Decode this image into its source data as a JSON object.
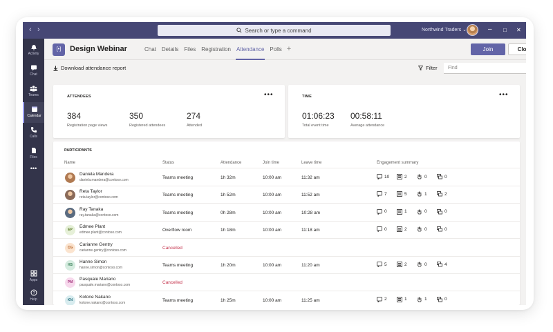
{
  "titlebar": {
    "search_placeholder": "Search or type a command",
    "org": "Northwind Traders",
    "back_glyph": "‹",
    "forward_glyph": "›",
    "minimize_glyph": "–",
    "restore_glyph": "□",
    "close_glyph": "✕",
    "org_chevron": "⌄"
  },
  "rail": [
    {
      "label": "Activity",
      "icon": "bell-icon"
    },
    {
      "label": "Chat",
      "icon": "chat-icon"
    },
    {
      "label": "Teams",
      "icon": "teams-icon"
    },
    {
      "label": "Calendar",
      "icon": "calendar-icon",
      "active": true
    },
    {
      "label": "Calls",
      "icon": "phone-icon"
    },
    {
      "label": "Files",
      "icon": "file-icon"
    },
    {
      "label": "Apps",
      "icon": "apps-icon"
    },
    {
      "label": "Help",
      "icon": "help-icon"
    }
  ],
  "rail_more": "•••",
  "header": {
    "channel_icon_text": "[•]",
    "title": "Design Webinar",
    "tabs": [
      "Chat",
      "Details",
      "Files",
      "Registration",
      "Attendance",
      "Polls"
    ],
    "active_tab": "Attendance",
    "add_tab": "+",
    "join_label": "Join",
    "close_label": "Close"
  },
  "toolbar": {
    "download_label": "Download attendance report",
    "filter_label": "Filter",
    "find_placeholder": "Find"
  },
  "attendees_card": {
    "title": "ATTENDEES",
    "more": "•••",
    "stats": [
      {
        "value": "384",
        "label": "Registration page views"
      },
      {
        "value": "350",
        "label": "Registered attendees"
      },
      {
        "value": "274",
        "label": "Attended"
      }
    ]
  },
  "time_card": {
    "title": "TIME",
    "more": "•••",
    "stats": [
      {
        "value": "01:06:23",
        "label": "Total event time"
      },
      {
        "value": "00:58:11",
        "label": "Average attendance"
      }
    ]
  },
  "participants": {
    "title": "PARTICIPANTS",
    "headers": {
      "name": "Name",
      "status": "Status",
      "attendance": "Attendance",
      "join": "Join time",
      "leave": "Leave time",
      "engagement": "Engagement summary"
    },
    "rows": [
      {
        "name": "Daniela Mandera",
        "email": "daniela.mandera@contoso.com",
        "initials": "",
        "avatar_color": "#b07a52",
        "status": "Teams meeting",
        "cancelled": false,
        "attendance": "1h 32m",
        "join": "10:00 am",
        "leave": "11:32 am",
        "engagement": [
          "10",
          "2",
          "0",
          "0"
        ]
      },
      {
        "name": "Reta Taylor",
        "email": "reta.taylor@contoso.com",
        "initials": "",
        "avatar_color": "#8a6a58",
        "status": "Teams meeting",
        "cancelled": false,
        "attendance": "1h 52m",
        "join": "10:00 am",
        "leave": "11:52 am",
        "engagement": [
          "7",
          "5",
          "1",
          "2"
        ]
      },
      {
        "name": "Ray Tanaka",
        "email": "ray.tanaka@contoso.com",
        "initials": "",
        "avatar_color": "#5a6b80",
        "status": "Teams meeting",
        "cancelled": false,
        "attendance": "0h 28m",
        "join": "10:00 am",
        "leave": "10:28 am",
        "engagement": [
          "0",
          "1",
          "0",
          "0"
        ]
      },
      {
        "name": "Edmee Plant",
        "email": "edmee.plant@contoso.com",
        "initials": "EP",
        "avatar_color": "#e6f0d8",
        "avatar_text": "#5b7a2a",
        "status": "Overflow room",
        "cancelled": false,
        "attendance": "1h 18m",
        "join": "10:00 am",
        "leave": "11:18 am",
        "engagement": [
          "0",
          "2",
          "0",
          "0"
        ]
      },
      {
        "name": "Carianne Gentry",
        "email": "carianne.gentry@contoso.com",
        "initials": "CG",
        "avatar_color": "#fbe4cf",
        "avatar_text": "#b0581a",
        "status": "Cancelled",
        "cancelled": true,
        "attendance": "",
        "join": "",
        "leave": "",
        "engagement": []
      },
      {
        "name": "Hanne Simon",
        "email": "hanne.simon@contoso.com",
        "initials": "HS",
        "avatar_color": "#d6ece0",
        "avatar_text": "#2f7a50",
        "status": "Teams meeting",
        "cancelled": false,
        "attendance": "1h 20m",
        "join": "10:00 am",
        "leave": "11:20 am",
        "engagement": [
          "5",
          "2",
          "0",
          "4"
        ]
      },
      {
        "name": "Pasquale Mariano",
        "email": "pasquale.mariano@contoso.com",
        "initials": "PM",
        "avatar_color": "#f7d8ec",
        "avatar_text": "#a2347c",
        "status": "Cancelled",
        "cancelled": true,
        "attendance": "",
        "join": "",
        "leave": "",
        "engagement": []
      },
      {
        "name": "Kotone Nakano",
        "email": "kotone.nakano@contoso.com",
        "initials": "KN",
        "avatar_color": "#d8ecef",
        "avatar_text": "#2a7380",
        "status": "Teams meeting",
        "cancelled": false,
        "attendance": "1h 25m",
        "join": "10:00 am",
        "leave": "11:25 am",
        "engagement": [
          "2",
          "1",
          "1",
          "0"
        ]
      }
    ]
  }
}
